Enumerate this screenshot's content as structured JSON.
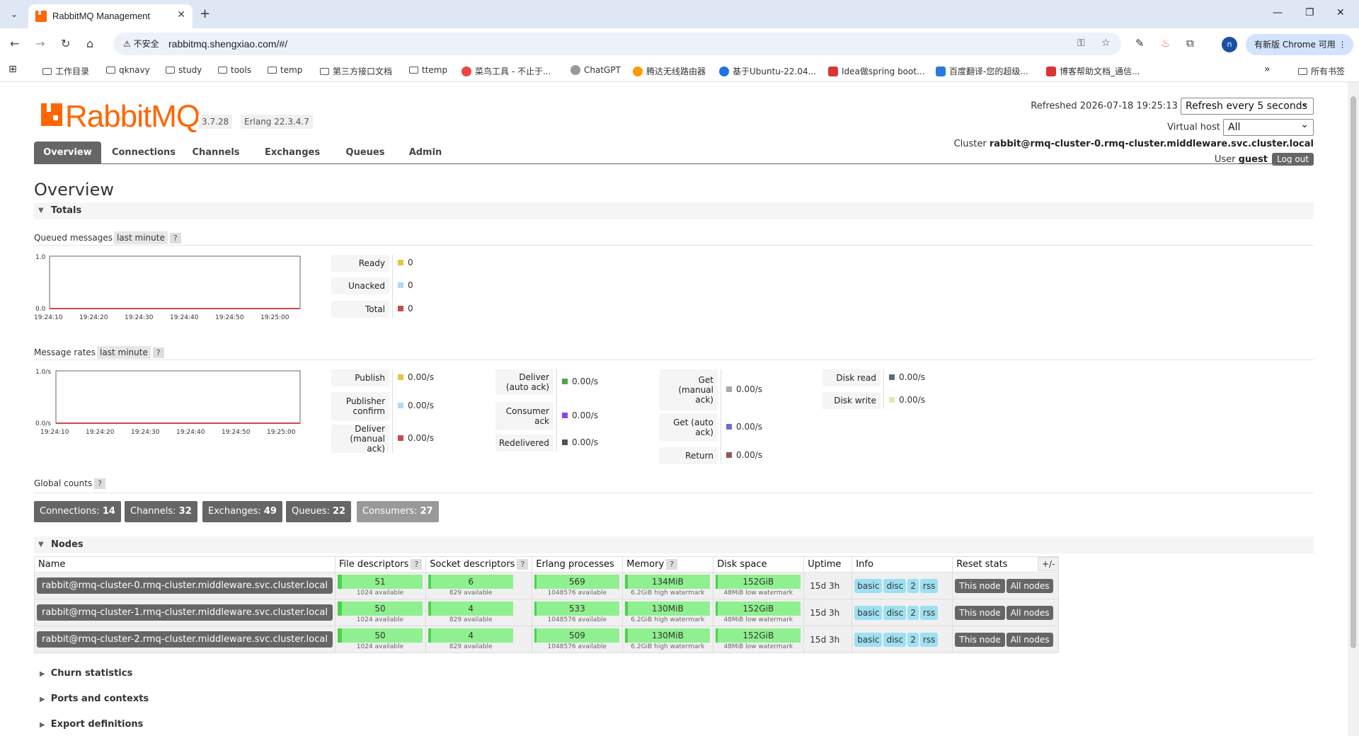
{
  "browser": {
    "tab_title": "RabbitMQ Management",
    "url": "rabbitmq.shengxiao.com/#/",
    "security_label": "不安全",
    "update_label": "有新版 Chrome 可用",
    "profile_initial": "n",
    "bookmarks": [
      "工作目录",
      "qknavy",
      "study",
      "tools",
      "temp",
      "第三方接口文档",
      "ttemp",
      "菜鸟工具 - 不止于...",
      "ChatGPT",
      "腾达无线路由器",
      "基于Ubuntu-22.04...",
      "Idea做spring boot...",
      "百度翻译-您的超级...",
      "博客帮助文档_通信..."
    ],
    "all_bookmarks": "所有书签",
    "colors": {
      "tabbar": "#dfe7f5",
      "omnibox": "#edf1f9",
      "update_button": "#d3e2fd"
    }
  },
  "app": {
    "logo_text": "RabbitMQ",
    "version": "3.7.28",
    "erlang": "Erlang 22.3.4.7",
    "refreshed_label": "Refreshed",
    "refreshed_time": "2026-07-18 19:25:13",
    "refresh_select": "Refresh every 5 seconds",
    "vhost_label": "Virtual host",
    "vhost_value": "All",
    "cluster_label": "Cluster",
    "cluster_name": "rabbit@rmq-cluster-0.rmq-cluster.middleware.svc.cluster.local",
    "user_label": "User",
    "user_name": "guest",
    "logout": "Log out",
    "brand_color": "#ff6600"
  },
  "nav": [
    "Overview",
    "Connections",
    "Channels",
    "Exchanges",
    "Queues",
    "Admin"
  ],
  "page_title": "Overview",
  "totals": {
    "heading": "Totals",
    "queued_label": "Queued messages",
    "rates_label": "Message rates",
    "range_chip": "last minute",
    "help": "?",
    "queued_legend": [
      {
        "label": "Ready",
        "value": "0",
        "color": "#edc240"
      },
      {
        "label": "Unacked",
        "value": "0",
        "color": "#afd8f8"
      },
      {
        "label": "Total",
        "value": "0",
        "color": "#cb4b4b"
      }
    ],
    "rates_legend": [
      [
        {
          "label": "Publish",
          "value": "0.00/s",
          "color": "#edc240"
        },
        {
          "label": "Publisher confirm",
          "value": "0.00/s",
          "color": "#afd8f8"
        },
        {
          "label": "Deliver (manual ack)",
          "value": "0.00/s",
          "color": "#cb4b4b"
        }
      ],
      [
        {
          "label": "Deliver (auto ack)",
          "value": "0.00/s",
          "color": "#4da74d"
        },
        {
          "label": "Consumer ack",
          "value": "0.00/s",
          "color": "#9440ed"
        },
        {
          "label": "Redelivered",
          "value": "0.00/s",
          "color": "#545454"
        }
      ],
      [
        {
          "label": "Get (manual ack)",
          "value": "0.00/s",
          "color": "#aaaaaa"
        },
        {
          "label": "Get (auto ack)",
          "value": "0.00/s",
          "color": "#7070cc"
        },
        {
          "label": "Return",
          "value": "0.00/s",
          "color": "#8d5b5b"
        }
      ],
      [
        {
          "label": "Disk read",
          "value": "0.00/s",
          "color": "#5a6e80"
        },
        {
          "label": "Disk write",
          "value": "0.00/s",
          "color": "#e6e6ad"
        }
      ]
    ]
  },
  "chart_data": [
    {
      "type": "line",
      "x": [
        "19:24:10",
        "19:24:20",
        "19:24:30",
        "19:24:40",
        "19:24:50",
        "19:25:00"
      ],
      "ytick_labels": [
        "1.0",
        "0.0"
      ],
      "ylim": [
        0,
        1
      ],
      "series": [
        {
          "values": [
            0,
            0,
            0,
            0,
            0,
            0
          ],
          "color": "#cb4b4b"
        }
      ]
    },
    {
      "type": "line",
      "x": [
        "19:24:10",
        "19:24:20",
        "19:24:30",
        "19:24:40",
        "19:24:50",
        "19:25:00"
      ],
      "ytick_labels": [
        "1.0/s",
        "0.0/s"
      ],
      "ylim": [
        0,
        1
      ],
      "series": [
        {
          "values": [
            0,
            0,
            0,
            0,
            0,
            0
          ],
          "color": "#cb4b4b"
        }
      ]
    }
  ],
  "global_counts": {
    "label": "Global counts",
    "items": [
      {
        "label": "Connections:",
        "value": "14"
      },
      {
        "label": "Channels:",
        "value": "32"
      },
      {
        "label": "Exchanges:",
        "value": "49"
      },
      {
        "label": "Queues:",
        "value": "22"
      },
      {
        "label": "Consumers:",
        "value": "27"
      }
    ]
  },
  "nodes": {
    "heading": "Nodes",
    "columns": [
      "Name",
      "File descriptors",
      "Socket descriptors",
      "Erlang processes",
      "Memory",
      "Disk space",
      "Uptime",
      "Info",
      "Reset stats"
    ],
    "plusminus": "+/-",
    "rows": [
      {
        "name": "rabbit@rmq-cluster-0.rmq-cluster.middleware.svc.cluster.local",
        "fd": "51",
        "fd_sub": "1024 available",
        "sock": "6",
        "sock_sub": "829 available",
        "proc": "569",
        "proc_sub": "1048576 available",
        "mem": "134MiB",
        "mem_sub": "6.2GiB high watermark",
        "disk": "152GiB",
        "disk_sub": "48MiB low watermark",
        "uptime": "15d 3h",
        "info": [
          "basic",
          "disc",
          "2",
          "rss"
        ],
        "reset": [
          "This node",
          "All nodes"
        ]
      },
      {
        "name": "rabbit@rmq-cluster-1.rmq-cluster.middleware.svc.cluster.local",
        "fd": "50",
        "fd_sub": "1024 available",
        "sock": "4",
        "sock_sub": "829 available",
        "proc": "533",
        "proc_sub": "1048576 available",
        "mem": "130MiB",
        "mem_sub": "6.2GiB high watermark",
        "disk": "152GiB",
        "disk_sub": "48MiB low watermark",
        "uptime": "15d 3h",
        "info": [
          "basic",
          "disc",
          "2",
          "rss"
        ],
        "reset": [
          "This node",
          "All nodes"
        ]
      },
      {
        "name": "rabbit@rmq-cluster-2.rmq-cluster.middleware.svc.cluster.local",
        "fd": "50",
        "fd_sub": "1024 available",
        "sock": "4",
        "sock_sub": "829 available",
        "proc": "509",
        "proc_sub": "1048576 available",
        "mem": "130MiB",
        "mem_sub": "6.2GiB high watermark",
        "disk": "152GiB",
        "disk_sub": "48MiB low watermark",
        "uptime": "15d 3h",
        "info": [
          "basic",
          "disc",
          "2",
          "rss"
        ],
        "reset": [
          "This node",
          "All nodes"
        ]
      }
    ]
  },
  "collapsed_sections": [
    "Churn statistics",
    "Ports and contexts",
    "Export definitions"
  ]
}
